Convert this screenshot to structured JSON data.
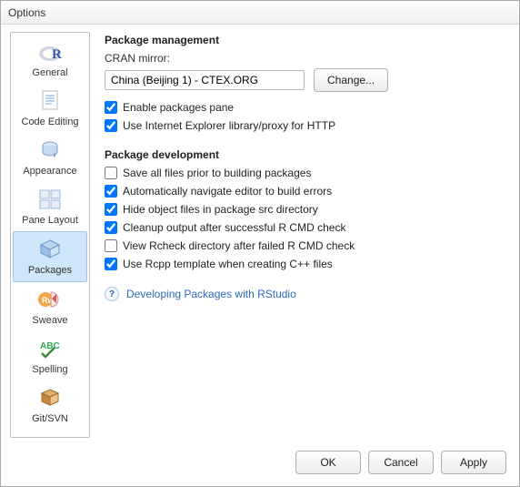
{
  "window": {
    "title": "Options"
  },
  "sidebar": {
    "items": [
      {
        "label": "General"
      },
      {
        "label": "Code Editing"
      },
      {
        "label": "Appearance"
      },
      {
        "label": "Pane Layout"
      },
      {
        "label": "Packages",
        "selected": true
      },
      {
        "label": "Sweave"
      },
      {
        "label": "Spelling"
      },
      {
        "label": "Git/SVN"
      }
    ]
  },
  "main": {
    "pkgMgmt": {
      "title": "Package management",
      "mirrorLabel": "CRAN mirror:",
      "mirrorValue": "China (Beijing 1) - CTEX.ORG",
      "changeBtn": "Change...",
      "enablePane": "Enable packages pane",
      "useIE": "Use Internet Explorer library/proxy for HTTP"
    },
    "pkgDev": {
      "title": "Package development",
      "saveAll": "Save all files prior to building packages",
      "autoNav": "Automatically navigate editor to build errors",
      "hideObj": "Hide object files in package src directory",
      "cleanup": "Cleanup output after successful R CMD check",
      "viewRcheck": "View Rcheck directory after failed R CMD check",
      "useRcpp": "Use Rcpp template when creating C++ files"
    },
    "helpLink": "Developing Packages with RStudio"
  },
  "footer": {
    "ok": "OK",
    "cancel": "Cancel",
    "apply": "Apply"
  }
}
